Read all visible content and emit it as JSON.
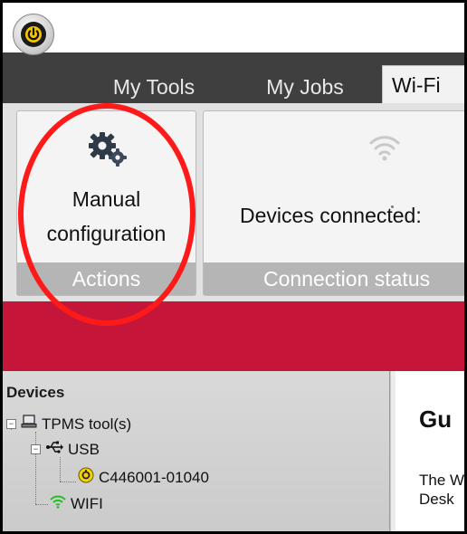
{
  "app": {
    "power_icon": "power-icon",
    "accent_color": "#c5163a"
  },
  "tabs": [
    {
      "label": "My Tools",
      "active": false
    },
    {
      "label": "My Jobs",
      "active": false
    },
    {
      "label": "Wi-Fi",
      "active": true
    }
  ],
  "ribbon": {
    "actions": {
      "button_line1": "Manual",
      "button_line2": "configuration",
      "button_icon": "gears-icon",
      "caption": "Actions"
    },
    "connection": {
      "text": "Devices connected:",
      "icon": "wifi-icon",
      "caption": "Connection status"
    }
  },
  "devices": {
    "title": "Devices",
    "tree": {
      "tools_label": "TPMS tool(s)",
      "usb_label": "USB",
      "device_id": "C446001-01040",
      "wifi_label": "WIFI"
    }
  },
  "guide": {
    "title": "Gu",
    "line1": "The W",
    "line2": "Desk"
  },
  "annotation": {
    "color": "#ff1a1a"
  }
}
